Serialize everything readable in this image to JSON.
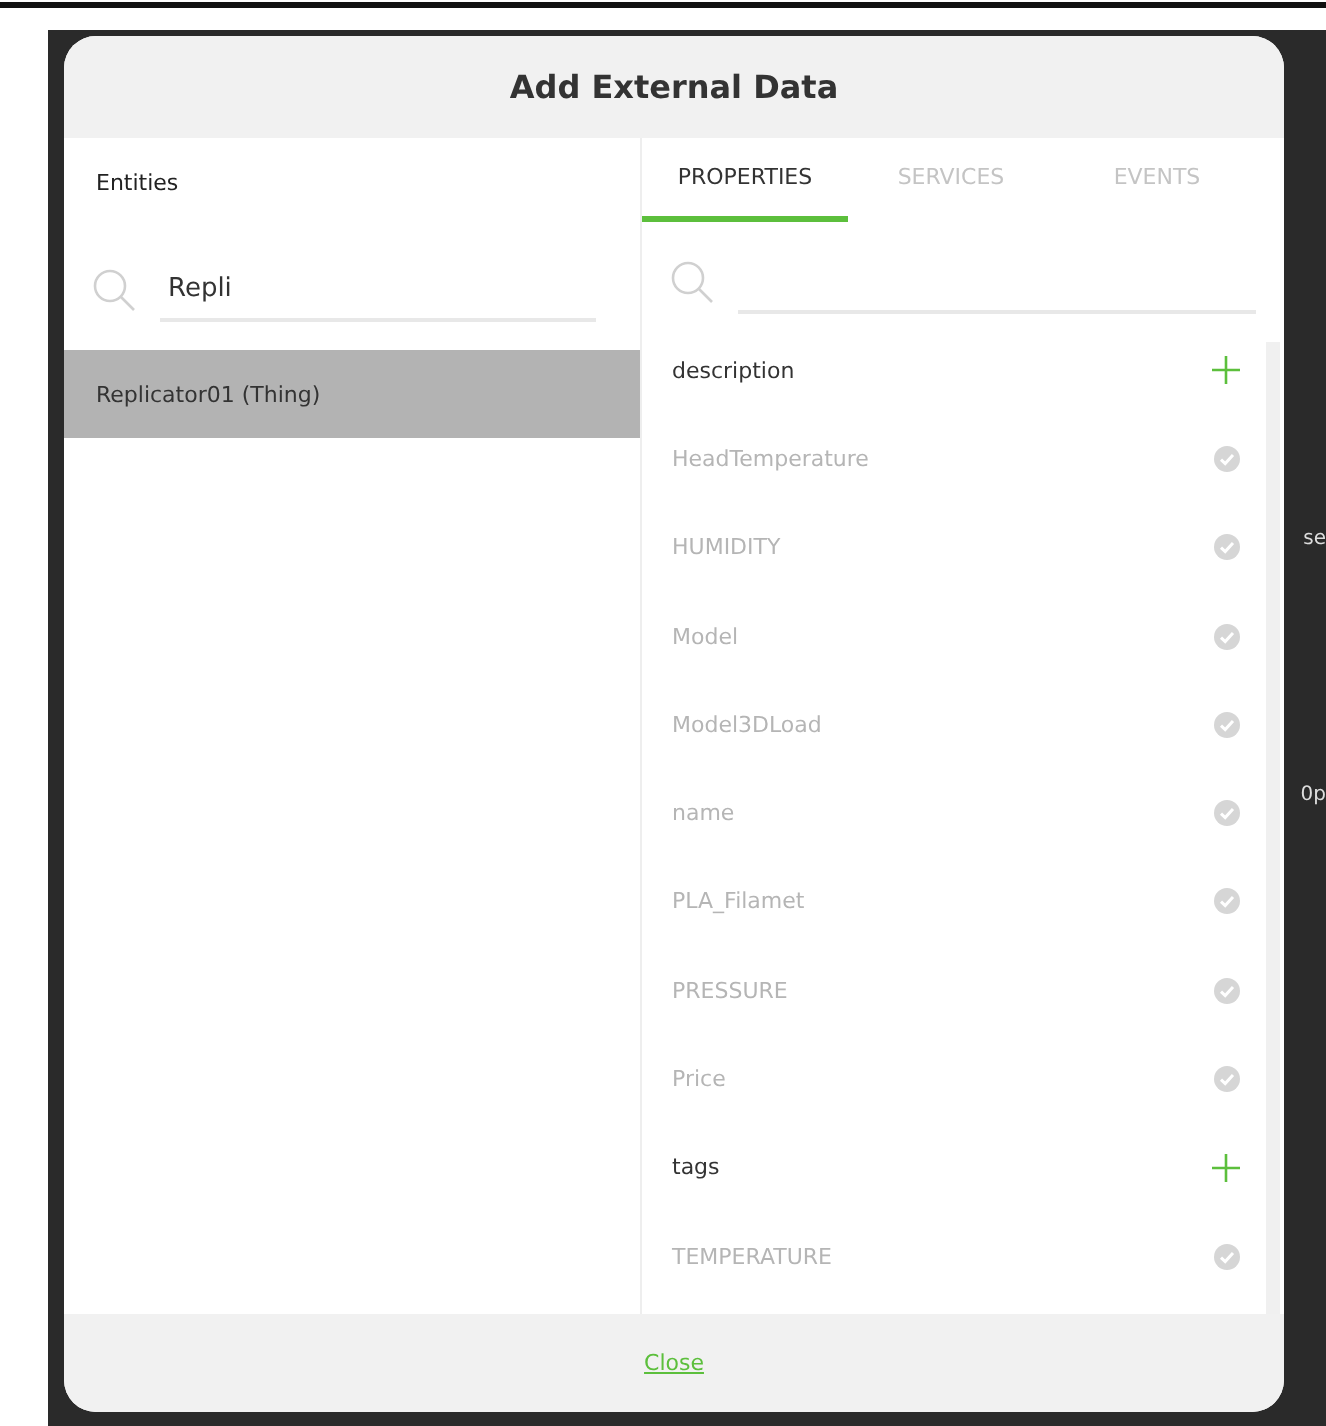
{
  "dialog": {
    "title": "Add External Data",
    "close_link": "Close"
  },
  "entities": {
    "label": "Entities",
    "search": {
      "value": "Repli"
    },
    "items": [
      {
        "label": "Replicator01 (Thing)",
        "selected": true
      }
    ]
  },
  "tabs": [
    {
      "label": "PROPERTIES",
      "selected": true
    },
    {
      "label": "SERVICES",
      "selected": false
    },
    {
      "label": "EVENTS",
      "selected": false
    }
  ],
  "properties": [
    {
      "name": "description",
      "added": false
    },
    {
      "name": "HeadTemperature",
      "added": true
    },
    {
      "name": "HUMIDITY",
      "added": true
    },
    {
      "name": "Model",
      "added": true
    },
    {
      "name": "Model3DLoad",
      "added": true
    },
    {
      "name": "name",
      "added": true
    },
    {
      "name": "PLA_Filamet",
      "added": true
    },
    {
      "name": "PRESSURE",
      "added": true
    },
    {
      "name": "Price",
      "added": true
    },
    {
      "name": "tags",
      "added": false
    },
    {
      "name": "TEMPERATURE",
      "added": true
    }
  ],
  "background_fragments": [
    "se",
    "0p"
  ]
}
